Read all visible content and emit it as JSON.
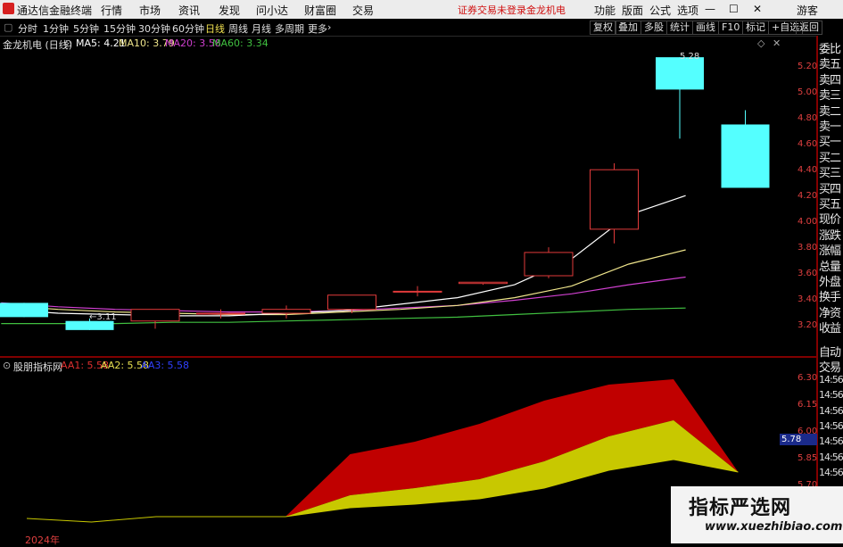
{
  "titlebar": {
    "app_name": "通达信金融终端",
    "menu": [
      "行情",
      "市场",
      "资讯",
      "发现",
      "问小达",
      "财富圈",
      "交易"
    ],
    "notice": "证券交易未登录",
    "stock": "金龙机电",
    "right_menu": [
      "功能",
      "版面",
      "公式",
      "选项"
    ],
    "guest": "游客"
  },
  "toolbar": {
    "periods": [
      "分时",
      "1分钟",
      "5分钟",
      "15分钟",
      "30分钟",
      "60分钟",
      "日线",
      "周线",
      "月线",
      "多周期",
      "更多"
    ],
    "active_period": "日线",
    "right_buttons": [
      "复权",
      "叠加",
      "多股",
      "统计",
      "画线",
      "F10",
      "标记",
      "+自选",
      "返回"
    ]
  },
  "main_info": {
    "title": "金龙机电 (日线)",
    "ma5": "MA5: 4.21",
    "ma10": "MA10: 3.79",
    "ma20": "MA20: 3.58",
    "ma60": "MA60: 3.34",
    "low_label": "3.11",
    "high_label": "5.28"
  },
  "sub_info": {
    "title": "股朋指标网",
    "aa1": "AA1: 5.58",
    "aa2": "AA2: 5.58",
    "aa3": "AA3: 5.58"
  },
  "sidebar": {
    "items": [
      "委比",
      "卖五",
      "卖四",
      "卖三",
      "卖二",
      "卖一",
      "买一",
      "买二",
      "买三",
      "买四",
      "买五",
      "现价",
      "涨跌",
      "涨幅",
      "总量",
      "外盘",
      "换手",
      "净资",
      "收益"
    ],
    "lower_items": [
      "自动",
      "交易",
      "14:56",
      "14:56",
      "14:56",
      "14:56",
      "14:56",
      "14:56",
      "14:56"
    ]
  },
  "axis": {
    "main_ticks": [
      "5.20",
      "5.00",
      "4.80",
      "4.60",
      "4.40",
      "4.20",
      "4.00",
      "3.80",
      "3.60",
      "3.40",
      "3.20"
    ],
    "sub_ticks": [
      "6.30",
      "6.15",
      "6.00",
      "5.85",
      "5.70",
      "5.55"
    ],
    "sub_current": "5.78"
  },
  "date_label": "2024年",
  "watermark": {
    "title": "指标严选网",
    "url": "www.xuezhibiao.com"
  },
  "colors": {
    "up": "#e03a3a",
    "down": "#54ffff",
    "ma5": "#ffffff",
    "ma10": "#f0e68c",
    "ma20": "#d040d0",
    "ma60": "#40c040",
    "aa1_fill": "#c00000",
    "aa2_fill": "#c8c800",
    "grid": "#800000"
  },
  "chart_data": {
    "type": "candlestick",
    "title": "金龙机电 (日线)",
    "ylim": [
      3.1,
      5.35
    ],
    "candles": [
      {
        "o": 3.38,
        "h": 3.38,
        "l": 3.27,
        "c": 3.27
      },
      {
        "o": 3.24,
        "h": 3.26,
        "l": 3.17,
        "c": 3.17
      },
      {
        "o": 3.24,
        "h": 3.33,
        "l": 3.18,
        "c": 3.33
      },
      {
        "o": 3.3,
        "h": 3.33,
        "l": 3.26,
        "c": 3.3
      },
      {
        "o": 3.3,
        "h": 3.36,
        "l": 3.26,
        "c": 3.33
      },
      {
        "o": 3.33,
        "h": 3.44,
        "l": 3.3,
        "c": 3.44
      },
      {
        "o": 3.47,
        "h": 3.51,
        "l": 3.43,
        "c": 3.47
      },
      {
        "o": 3.53,
        "h": 3.54,
        "l": 3.52,
        "c": 3.54
      },
      {
        "o": 3.59,
        "h": 3.81,
        "l": 3.57,
        "c": 3.77
      },
      {
        "o": 3.95,
        "h": 4.46,
        "l": 3.84,
        "c": 4.41
      },
      {
        "o": 5.28,
        "h": 5.28,
        "l": 4.65,
        "c": 5.03
      },
      {
        "o": 4.76,
        "h": 4.87,
        "l": 4.27,
        "c": 4.27
      }
    ],
    "ma5": [
      3.33,
      3.3,
      3.29,
      3.28,
      3.28,
      3.3,
      3.32,
      3.37,
      3.42,
      3.52,
      3.72,
      4.06,
      4.21
    ],
    "ma10": [
      3.36,
      3.33,
      3.31,
      3.3,
      3.29,
      3.29,
      3.31,
      3.33,
      3.36,
      3.42,
      3.51,
      3.68,
      3.79
    ],
    "ma20": [
      3.38,
      3.35,
      3.33,
      3.32,
      3.31,
      3.31,
      3.32,
      3.34,
      3.36,
      3.4,
      3.45,
      3.52,
      3.58
    ],
    "ma60": [
      3.22,
      3.22,
      3.22,
      3.23,
      3.23,
      3.24,
      3.25,
      3.26,
      3.27,
      3.29,
      3.31,
      3.33,
      3.34
    ],
    "sub": {
      "ylim": [
        5.5,
        6.35
      ],
      "aa1": [
        5.52,
        5.5,
        5.53,
        5.53,
        5.53,
        5.88,
        5.95,
        6.05,
        6.18,
        6.27,
        6.3,
        5.78
      ],
      "aa2": [
        5.52,
        5.5,
        5.53,
        5.53,
        5.53,
        5.65,
        5.69,
        5.74,
        5.84,
        5.98,
        6.07,
        5.78
      ],
      "aa3": [
        5.52,
        5.5,
        5.53,
        5.53,
        5.53,
        5.58,
        5.6,
        5.63,
        5.69,
        5.79,
        5.85,
        5.78
      ]
    }
  }
}
